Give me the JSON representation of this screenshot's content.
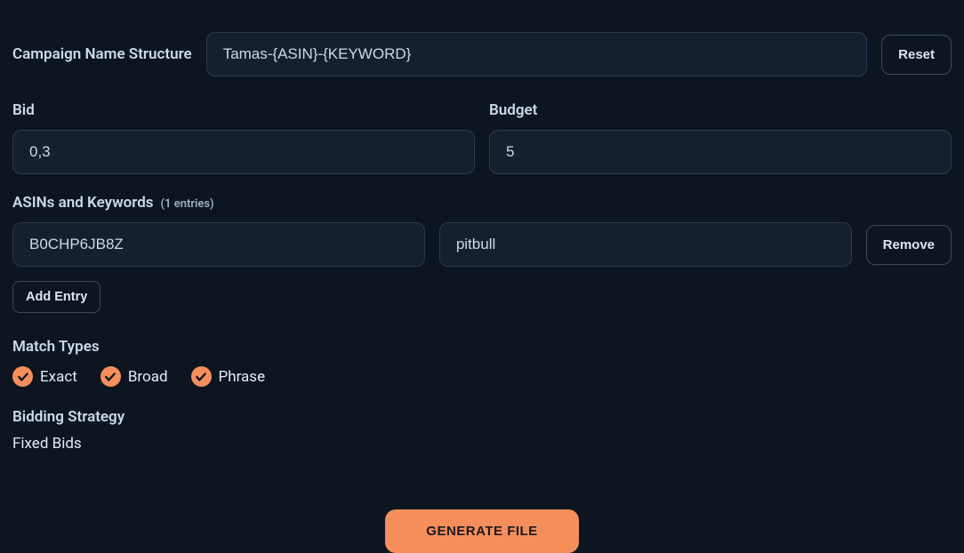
{
  "campaign": {
    "label": "Campaign Name Structure",
    "value": "Tamas-{ASIN}-{KEYWORD}",
    "reset_label": "Reset"
  },
  "bid": {
    "label": "Bid",
    "value": "0,3"
  },
  "budget": {
    "label": "Budget",
    "value": "5"
  },
  "asin_keywords": {
    "label": "ASINs and Keywords",
    "count_label": "(1 entries)",
    "entries": [
      {
        "asin": "B0CHP6JB8Z",
        "keyword": "pitbull"
      }
    ],
    "remove_label": "Remove",
    "add_label": "Add Entry"
  },
  "match_types": {
    "label": "Match Types",
    "options": [
      {
        "label": "Exact",
        "checked": true
      },
      {
        "label": "Broad",
        "checked": true
      },
      {
        "label": "Phrase",
        "checked": true
      }
    ]
  },
  "bidding_strategy": {
    "label": "Bidding Strategy",
    "value": "Fixed Bids"
  },
  "generate": {
    "label": "GENERATE FILE"
  },
  "colors": {
    "accent": "#f68e5c",
    "bg": "#0d1520",
    "input_bg": "#15202e"
  }
}
